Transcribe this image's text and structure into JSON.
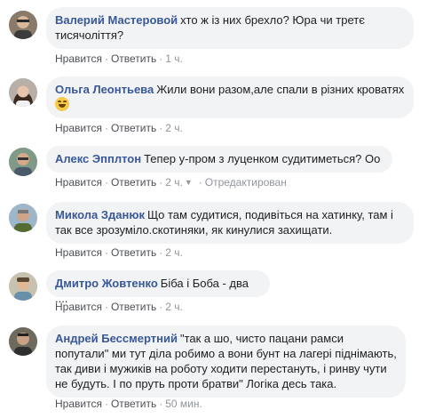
{
  "actions": {
    "like": "Нравится",
    "reply": "Ответить",
    "separator": "·",
    "edited": "Отредактирован"
  },
  "comments": [
    {
      "author": "Валерий Мастеровой",
      "text": "хто ж із них брехло? Юра чи третє тисячоліття?",
      "time": "1 ч."
    },
    {
      "author": "Ольга Леонтьева",
      "text": "Жили вони разом,але спали в різних кроватях",
      "emoji": "laughing-face",
      "time": "2 ч."
    },
    {
      "author": "Алекс Эпплтон",
      "text": "Тепер у-пром з луценком судитиметься? Оо",
      "time": "2 ч."
    },
    {
      "author": "Микола Зданюк",
      "text": "Що там судитися, подивіться на хатинку, там і так все зрозуміло.скотиняки, як кинулися захищати.",
      "time": "2 ч."
    },
    {
      "author": "Дмитро Жовтенко",
      "text": "Біба і Боба - два ....",
      "time": "2 ч."
    },
    {
      "author": "Андрей Бессмертний",
      "text": "\"так а шо, чисто пацани рамси попутали\" ми тут діла робимо а вони бунт на лагері піднімають, так диви і мужиків на роботу ходити перестануть, і ринву чути не будуть. І по пруть проти братви\" Логіка десь така.",
      "time": "50 мин."
    }
  ]
}
